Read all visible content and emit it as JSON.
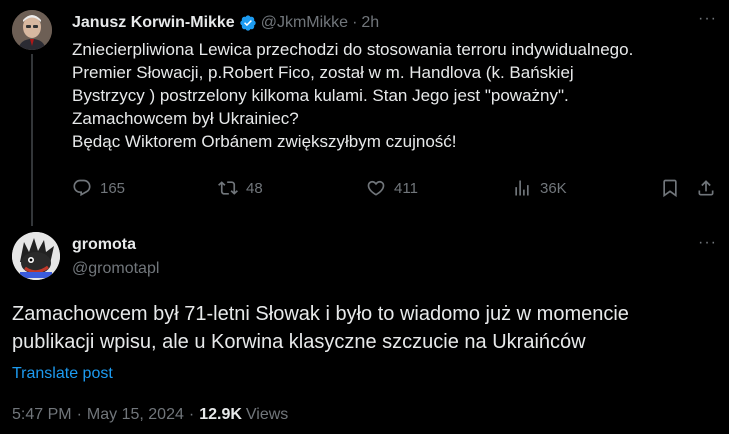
{
  "parent_tweet": {
    "author_name": "Janusz Korwin-Mikke",
    "handle": "@JkmMikke",
    "separator": "·",
    "time": "2h",
    "more_label": "···",
    "text_lines": [
      "Zniecierpliwiona Lewica przechodzi do stosowania terroru indywidualnego.",
      "Premier Słowacji, p.Robert Fico, został w m. Handlova (k. Bańskiej",
      "Bystrzycy ) postrzelony kilkoma kulami. Stan Jego jest \"poważny\".",
      "Zamachowcem był Ukrainiec?",
      "Będąc Wiktorem Orbánem zwiększyłbym czujność!"
    ],
    "actions": {
      "replies": "165",
      "reposts": "48",
      "likes": "411",
      "views": "36K"
    },
    "verified_color": "#1d9bf0"
  },
  "reply_tweet": {
    "author_name": "gromota",
    "handle": "@gromotapl",
    "more_label": "···",
    "text_lines": [
      "Zamachowcem był 71-letni Słowak i było to wiadomo już w momencie",
      "publikacji wpisu, ale u Korwina klasyczne szczucie na Ukraińców"
    ],
    "translate_label": "Translate post",
    "meta": {
      "time": "5:47 PM",
      "sep1": "·",
      "date": "May 15, 2024",
      "sep2": "·",
      "views_count": "12.9K",
      "views_label": "Views"
    }
  },
  "colors": {
    "background": "#000000",
    "text": "#e7e9ea",
    "muted": "#71767b",
    "accent": "#1d9bf0",
    "thread_line": "#333639"
  },
  "icons": [
    "reply-icon",
    "repost-icon",
    "like-icon",
    "views-icon",
    "bookmark-icon",
    "share-icon",
    "verified-badge-icon"
  ]
}
